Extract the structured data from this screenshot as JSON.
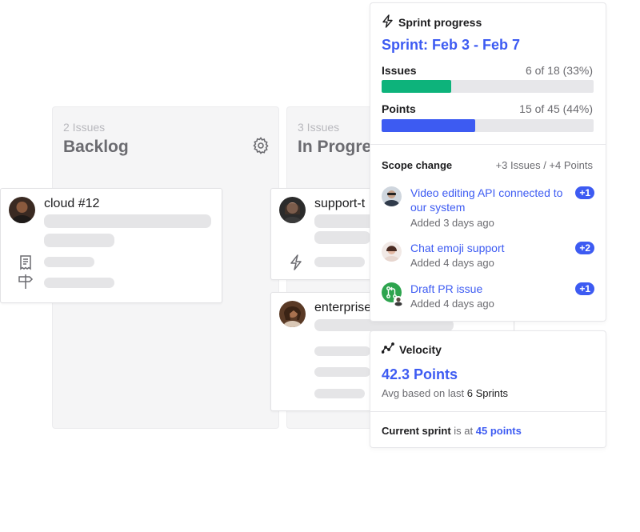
{
  "board": {
    "columns": [
      {
        "count": "2 Issues",
        "title": "Backlog"
      },
      {
        "count": "3 Issues",
        "title": "In Progre"
      }
    ],
    "cards": [
      {
        "title": "cloud #12"
      },
      {
        "title": "support-t"
      },
      {
        "title": "enterprise"
      }
    ]
  },
  "sprint": {
    "header": "Sprint progress",
    "name": "Sprint: Feb 3 - Feb 7",
    "issues": {
      "label": "Issues",
      "value": "6 of 18 (33%)",
      "fraction": 0.33,
      "color": "#0db37b"
    },
    "points": {
      "label": "Points",
      "value": "15 of 45 (44%)",
      "fraction": 0.44,
      "color": "#3d5bf2"
    },
    "scope": {
      "label": "Scope change",
      "value": "+3 Issues / +4 Points",
      "items": [
        {
          "title": "Video editing API connected to our system",
          "added": "Added 3 days ago",
          "badge": "+1"
        },
        {
          "title": "Chat emoji support",
          "added": "Added 4 days ago",
          "badge": "+2"
        },
        {
          "title": "Draft PR issue",
          "added": "Added 4 days ago",
          "badge": "+1"
        }
      ]
    }
  },
  "velocity": {
    "header": "Velocity",
    "value": "42.3 Points",
    "sub_prefix": "Avg based on last",
    "sub_count": "6 Sprints",
    "current_label": "Current sprint",
    "current_mid": "is at",
    "current_value": "45 points"
  },
  "icons": {
    "gear": "gear-icon",
    "lightning": "lightning-icon",
    "velocity": "trend-icon",
    "receipt": "receipt-icon",
    "signpost": "signpost-icon",
    "pull_request": "pull-request-icon"
  },
  "colors": {
    "accent": "#3d5bf2",
    "success": "#0db37b",
    "pr_green": "#2da44e"
  }
}
